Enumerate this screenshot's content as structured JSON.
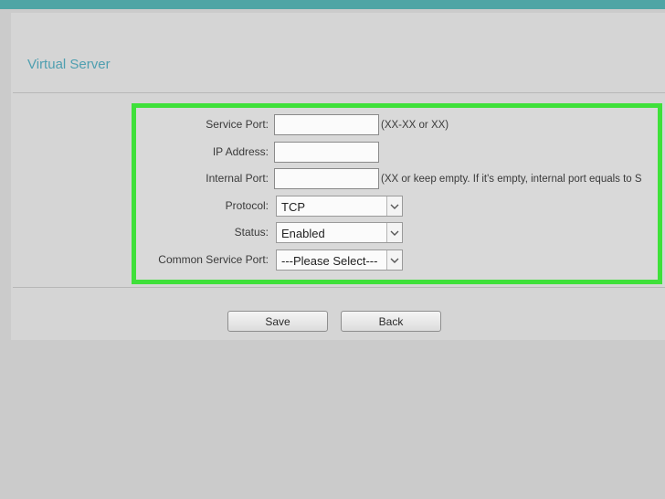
{
  "header": {
    "title": "Virtual Server"
  },
  "form": {
    "service_port": {
      "label": "Service Port:",
      "value": "",
      "hint": "(XX-XX or XX)"
    },
    "ip_address": {
      "label": "IP Address:",
      "value": ""
    },
    "internal_port": {
      "label": "Internal Port:",
      "value": "",
      "hint": "(XX or keep empty. If it's empty, internal port equals to S"
    },
    "protocol": {
      "label": "Protocol:",
      "selected": "TCP"
    },
    "status": {
      "label": "Status:",
      "selected": "Enabled"
    },
    "common_service_port": {
      "label": "Common Service Port:",
      "selected": "---Please Select---"
    }
  },
  "actions": {
    "save_label": "Save",
    "back_label": "Back"
  },
  "colors": {
    "highlight": "#3fe03a",
    "topbar": "#4fa5a5",
    "title": "#4f9fb0"
  }
}
